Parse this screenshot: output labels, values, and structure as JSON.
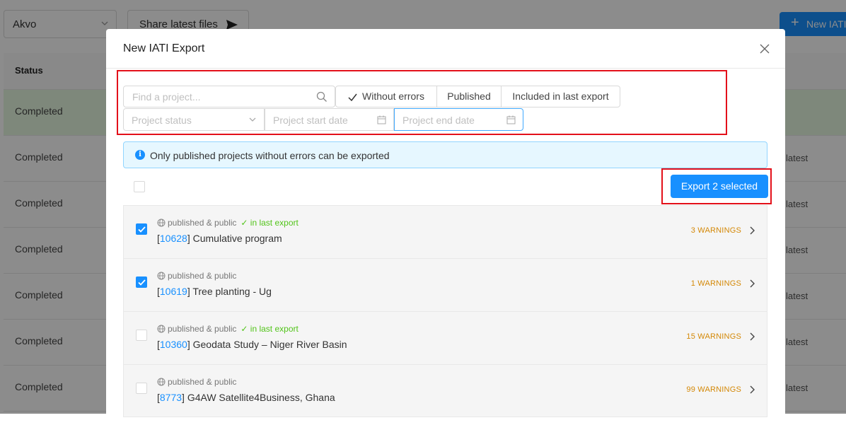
{
  "background": {
    "org_select": "Akvo",
    "share_button": "Share latest files",
    "new_button": "New IATI",
    "table_header": "Status",
    "rows": [
      {
        "status": "Completed",
        "latest": ""
      },
      {
        "status": "Completed",
        "latest": "latest"
      },
      {
        "status": "Completed",
        "latest": "latest"
      },
      {
        "status": "Completed",
        "latest": "latest"
      },
      {
        "status": "Completed",
        "latest": "latest"
      },
      {
        "status": "Completed",
        "latest": "latest"
      },
      {
        "status": "Completed",
        "latest": "latest"
      }
    ]
  },
  "modal": {
    "title": "New IATI Export",
    "search_placeholder": "Find a project...",
    "filters": {
      "without_errors": "Without errors",
      "published": "Published",
      "included_last": "Included in last export"
    },
    "project_status_placeholder": "Project status",
    "start_date_placeholder": "Project start date",
    "end_date_placeholder": "Project end date",
    "info_text": "Only published projects without errors can be exported",
    "export_button": "Export 2 selected",
    "projects": [
      {
        "checked": true,
        "status": "published & public",
        "in_last_export": "in last export",
        "id": "10628",
        "name": "Cumulative program",
        "warnings": "3 WARNINGS"
      },
      {
        "checked": true,
        "status": "published & public",
        "in_last_export": "",
        "id": "10619",
        "name": "Tree planting - Ug",
        "warnings": "1 WARNINGS"
      },
      {
        "checked": false,
        "status": "published & public",
        "in_last_export": "in last export",
        "id": "10360",
        "name": "Geodata Study – Niger River Basin",
        "warnings": "15 WARNINGS"
      },
      {
        "checked": false,
        "status": "published & public",
        "in_last_export": "",
        "id": "8773",
        "name": "G4AW Satellite4Business, Ghana",
        "warnings": "99 WARNINGS"
      }
    ]
  },
  "colors": {
    "primary": "#1890ff",
    "highlight_box": "#e3101a",
    "warning": "#d48806",
    "success": "#52c41a"
  }
}
